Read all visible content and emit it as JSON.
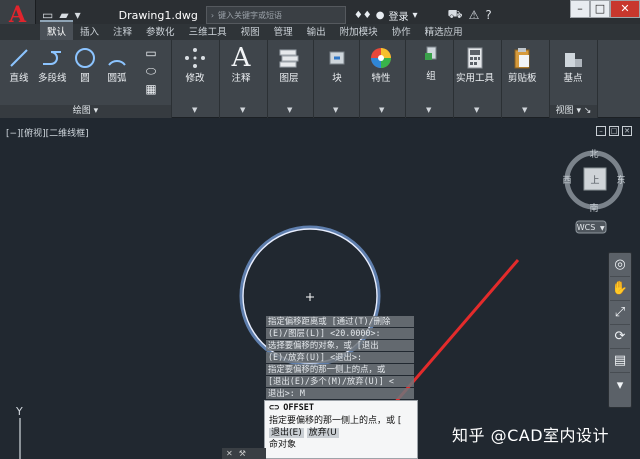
{
  "app": {
    "logo": "A",
    "doc_title": "Drawing1.dwg",
    "search_placeholder": "键入关键字或短语",
    "login": "登录",
    "help": "?"
  },
  "tabs": [
    "默认",
    "插入",
    "注释",
    "参数化",
    "三维工具",
    "视图",
    "管理",
    "输出",
    "附加模块",
    "协作",
    "精选应用"
  ],
  "ribbon": {
    "draw": {
      "label": "绘图",
      "tools": [
        "直线",
        "多段线",
        "圆",
        "圆弧"
      ]
    },
    "modify": "修改",
    "annotation": "注释",
    "layers": "图层",
    "block": "块",
    "properties": "特性",
    "groups": "组",
    "utilities": "实用工具",
    "clipboard": "剪贴板",
    "base": "基点",
    "view": "视图"
  },
  "viewport": {
    "label": "[−][俯视][二维线框]",
    "compass": {
      "north": "北",
      "south": "南",
      "west": "西",
      "east": "东",
      "center": "上"
    },
    "wcs": "WCS",
    "ucs_y": "Y"
  },
  "command_history": [
    "指定偏移距离或 [通过(T)/删除",
    "(E)/图层(L)] <20.0000>:",
    "选择要偏移的对象，或 [退出",
    "(E)/放弃(U)] <退出>:",
    "指定要偏移的那一侧上的点，或",
    "[退出(E)/多个(M)/放弃(U)] <",
    "退出>: M"
  ],
  "command_box": {
    "name": "OFFSET",
    "prompt": "指定要偏移的那一侧上的点，或",
    "bracket": "[",
    "opt_exit": "退出(E)",
    "opt_undo": "放弃(U",
    "current": "命对象"
  },
  "watermark": "知乎 @CAD室内设计",
  "colors": {
    "canvas": "#212830",
    "circle": "#d8e2ff",
    "arrow": "#e32b2b",
    "ribbon": "#3f454b"
  }
}
